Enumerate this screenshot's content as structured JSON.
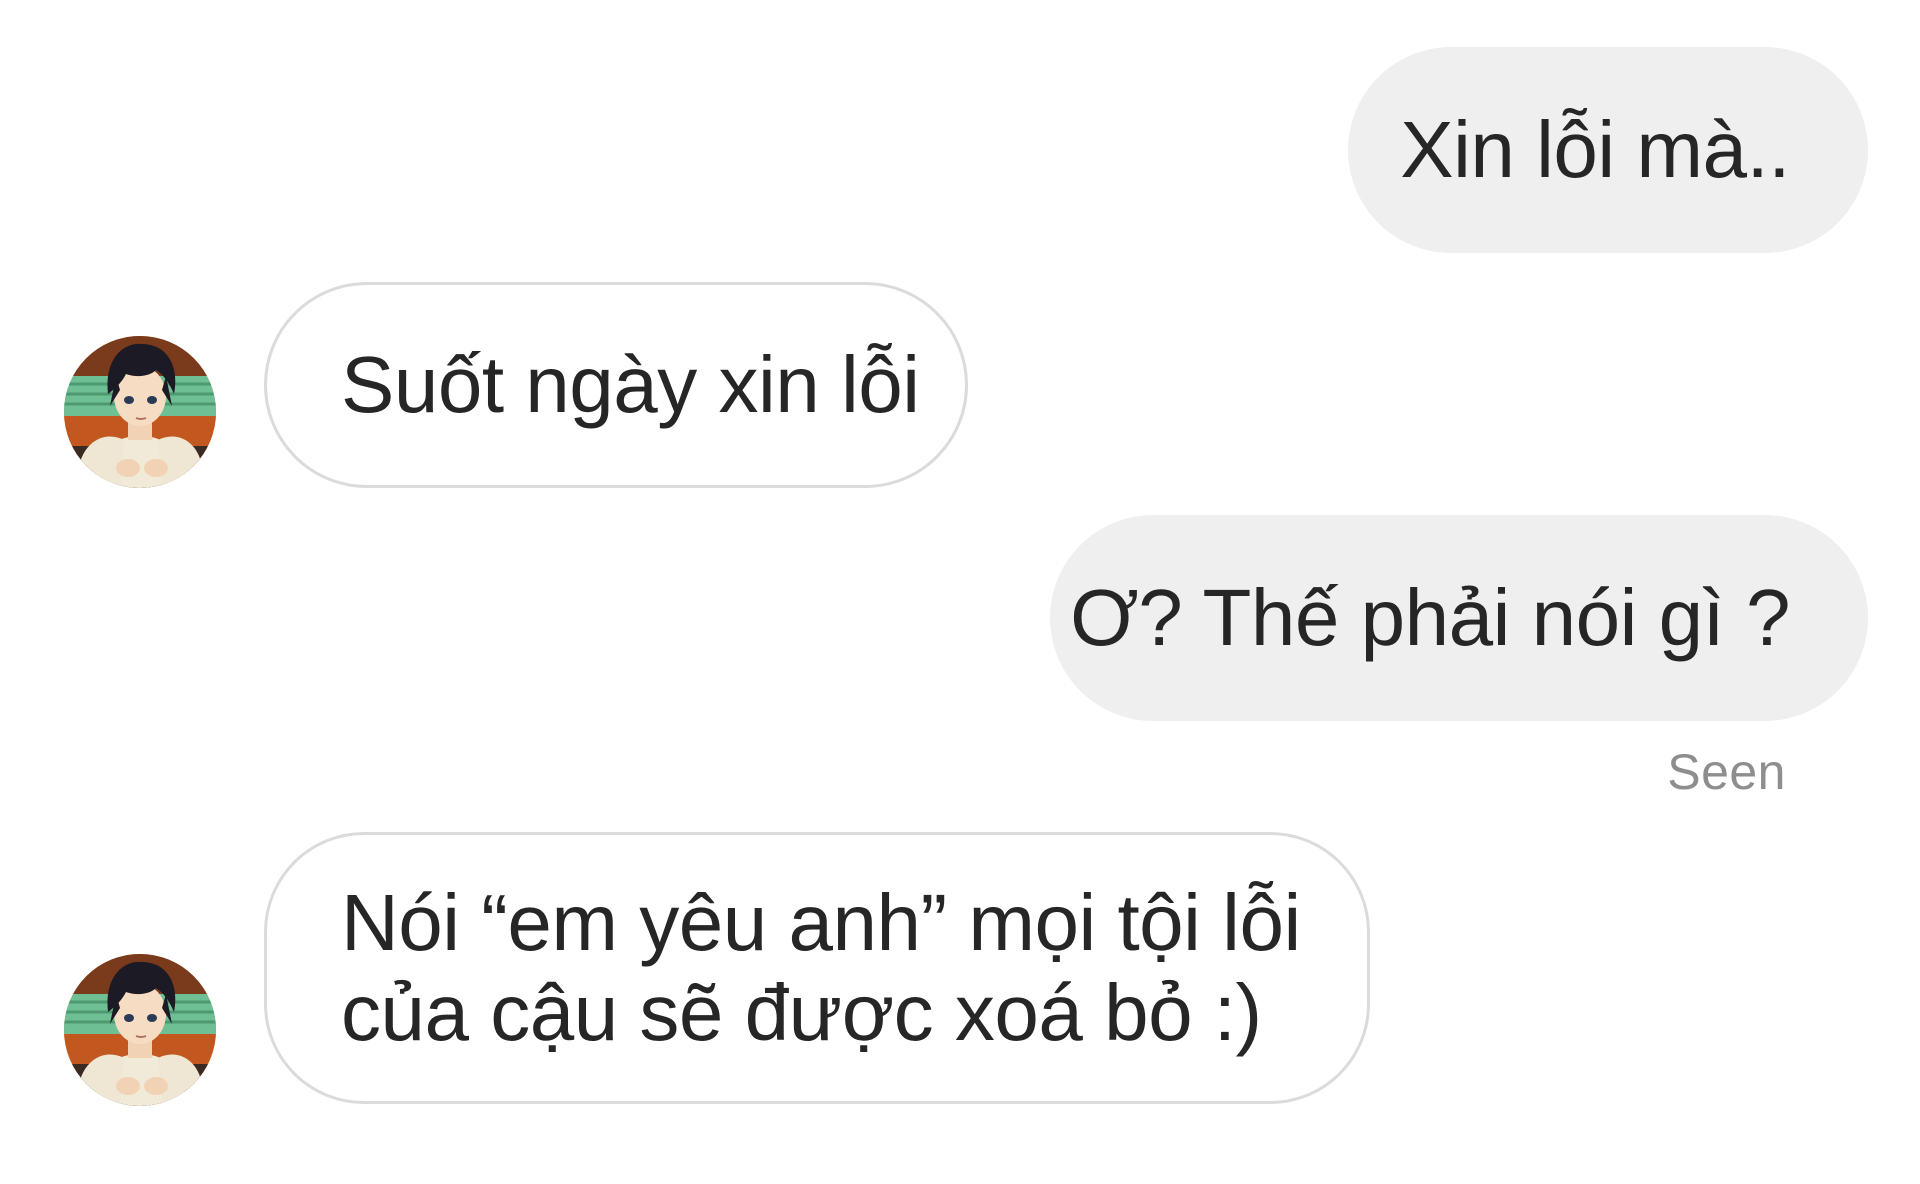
{
  "conversation": {
    "messages": [
      {
        "sender": "me",
        "text": "Xin lỗi mà.."
      },
      {
        "sender": "other",
        "text": "Suốt ngày xin lỗi"
      },
      {
        "sender": "me",
        "text": "Ơ? Thế phải nói gì ?"
      },
      {
        "sender": "other",
        "lines": [
          "Nói “em yêu anh” mọi tội lỗi",
          "của cậu sẽ được xoá bỏ :)"
        ]
      }
    ],
    "seen_label": "Seen"
  },
  "colors": {
    "outgoing_bubble": "#efefef",
    "incoming_border": "#dbdbdb",
    "text": "#262626",
    "seen_text": "#8e8e8e"
  },
  "icons": {
    "avatar": "anime-boy-avatar"
  }
}
